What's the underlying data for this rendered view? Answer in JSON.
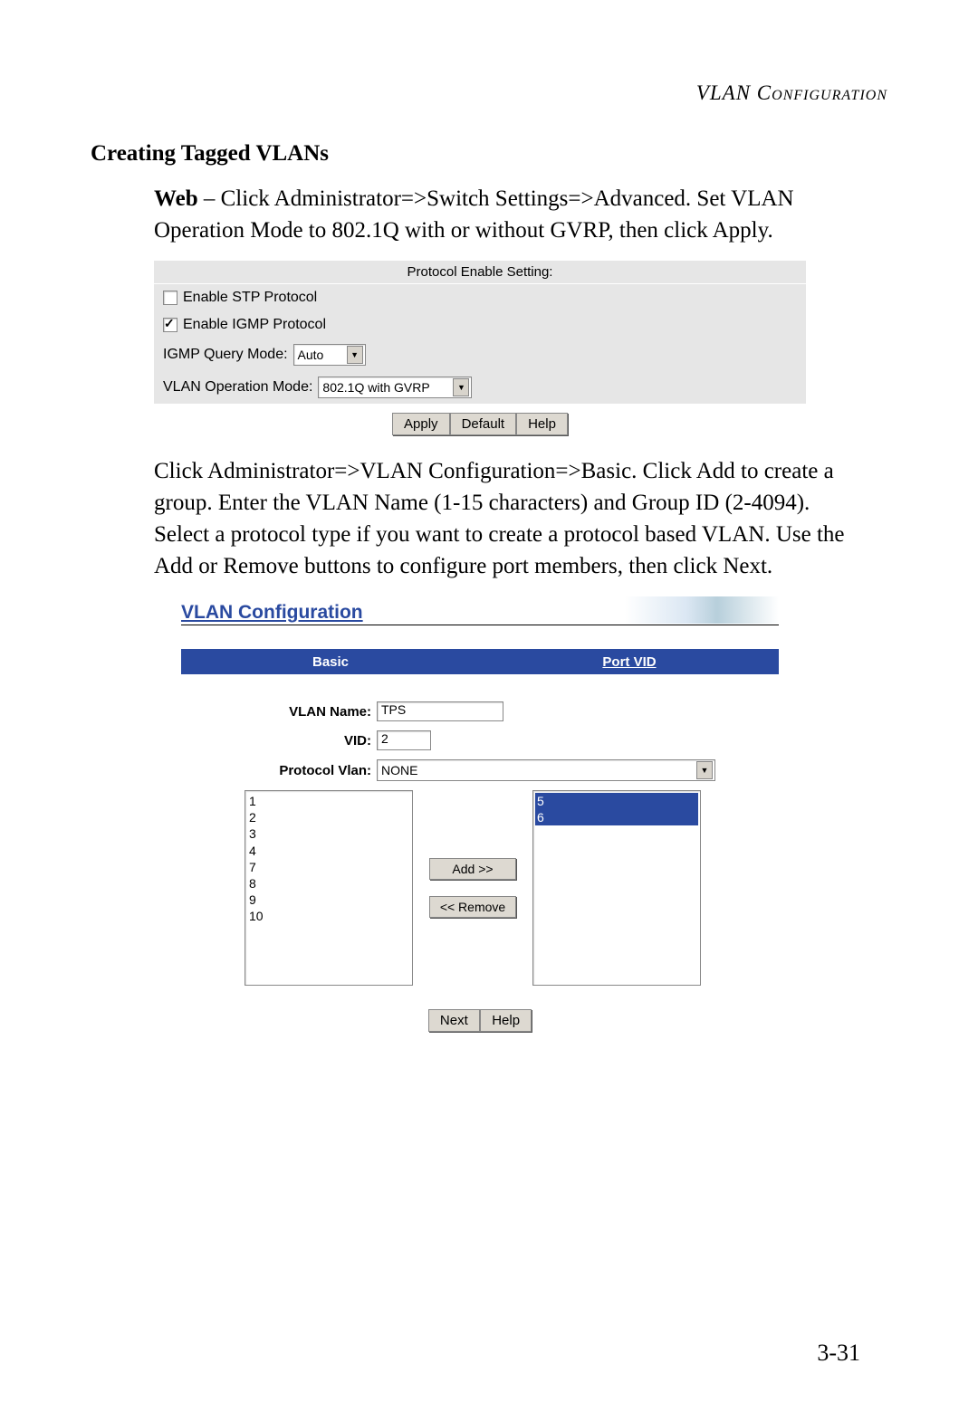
{
  "header": "VLAN Configuration",
  "section_title": "Creating Tagged VLANs",
  "para1": "Web – Click Administrator=>Switch Settings=>Advanced. Set VLAN Operation Mode to 802.1Q with or without GVRP, then click Apply.",
  "para2": "Click Administrator=>VLAN Configuration=>Basic. Click Add to create a group. Enter the VLAN Name (1-15 characters) and Group ID (2-4094). Select a protocol type if you want to create a protocol based VLAN. Use the Add or Remove buttons to configure port members, then click Next.",
  "panel1": {
    "title": "Protocol Enable Setting:",
    "stp_label": "Enable STP Protocol",
    "stp_checked": false,
    "igmp_label": "Enable IGMP Protocol",
    "igmp_checked": true,
    "igmp_query_label": "IGMP Query Mode:",
    "igmp_query_value": "Auto",
    "vlan_op_label": "VLAN Operation Mode:",
    "vlan_op_value": "802.1Q with GVRP",
    "btn_apply": "Apply",
    "btn_default": "Default",
    "btn_help": "Help"
  },
  "panel2": {
    "header": "VLAN Configuration",
    "tab_basic": "Basic",
    "tab_port": "Port VID",
    "vlan_name_label": "VLAN Name:",
    "vlan_name_value": "TPS",
    "vid_label": "VID:",
    "vid_value": "2",
    "protocol_label": "Protocol Vlan:",
    "protocol_value": "NONE",
    "left_ports": [
      "1",
      "2",
      "3",
      "4",
      "7",
      "8",
      "9",
      "10"
    ],
    "right_ports": [
      "5",
      "6"
    ],
    "btn_add": "Add   >>",
    "btn_remove": "<< Remove",
    "btn_next": "Next",
    "btn_help": "Help"
  },
  "page_number": "3-31"
}
